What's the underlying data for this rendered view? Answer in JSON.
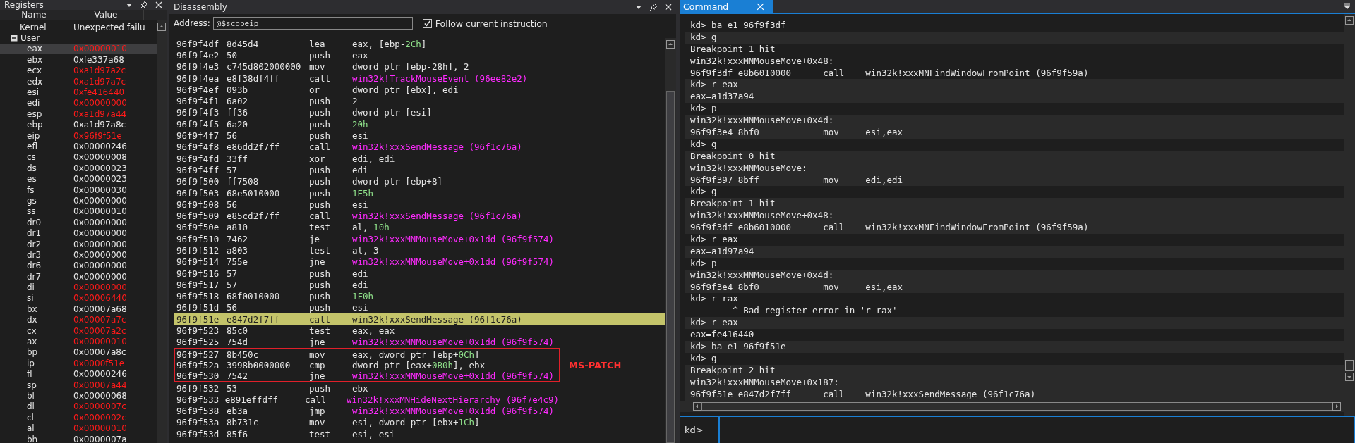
{
  "registers": {
    "title": "Registers",
    "columns": [
      "Name",
      "Value"
    ],
    "kernel": {
      "name": "Kernel",
      "value": "Unexpected failu"
    },
    "user": {
      "name": "User",
      "expanded": true,
      "items": [
        {
          "name": "eax",
          "value": "0x00000010",
          "changed": true,
          "selected": true
        },
        {
          "name": "ebx",
          "value": "0xfe337a68",
          "changed": false,
          "selected": false
        },
        {
          "name": "ecx",
          "value": "0xa1d97a2c",
          "changed": true,
          "selected": false
        },
        {
          "name": "edx",
          "value": "0xa1d97a7c",
          "changed": true,
          "selected": false
        },
        {
          "name": "esi",
          "value": "0xfe416440",
          "changed": true,
          "selected": false
        },
        {
          "name": "edi",
          "value": "0x00000000",
          "changed": true,
          "selected": false
        },
        {
          "name": "esp",
          "value": "0xa1d97a44",
          "changed": true,
          "selected": false
        },
        {
          "name": "ebp",
          "value": "0xa1d97a8c",
          "changed": false,
          "selected": false
        },
        {
          "name": "eip",
          "value": "0x96f9f51e",
          "changed": true,
          "selected": false
        },
        {
          "name": "efl",
          "value": "0x00000246",
          "changed": false,
          "selected": false
        },
        {
          "name": "cs",
          "value": "0x00000008",
          "changed": false,
          "selected": false
        },
        {
          "name": "ds",
          "value": "0x00000023",
          "changed": false,
          "selected": false
        },
        {
          "name": "es",
          "value": "0x00000023",
          "changed": false,
          "selected": false
        },
        {
          "name": "fs",
          "value": "0x00000030",
          "changed": false,
          "selected": false
        },
        {
          "name": "gs",
          "value": "0x00000000",
          "changed": false,
          "selected": false
        },
        {
          "name": "ss",
          "value": "0x00000010",
          "changed": false,
          "selected": false
        },
        {
          "name": "dr0",
          "value": "0x00000000",
          "changed": false,
          "selected": false
        },
        {
          "name": "dr1",
          "value": "0x00000000",
          "changed": false,
          "selected": false
        },
        {
          "name": "dr2",
          "value": "0x00000000",
          "changed": false,
          "selected": false
        },
        {
          "name": "dr3",
          "value": "0x00000000",
          "changed": false,
          "selected": false
        },
        {
          "name": "dr6",
          "value": "0x00000000",
          "changed": false,
          "selected": false
        },
        {
          "name": "dr7",
          "value": "0x00000000",
          "changed": false,
          "selected": false
        },
        {
          "name": "di",
          "value": "0x00000000",
          "changed": true,
          "selected": false
        },
        {
          "name": "si",
          "value": "0x00006440",
          "changed": true,
          "selected": false
        },
        {
          "name": "bx",
          "value": "0x00007a68",
          "changed": false,
          "selected": false
        },
        {
          "name": "dx",
          "value": "0x00007a7c",
          "changed": true,
          "selected": false
        },
        {
          "name": "cx",
          "value": "0x00007a2c",
          "changed": true,
          "selected": false
        },
        {
          "name": "ax",
          "value": "0x00000010",
          "changed": true,
          "selected": false
        },
        {
          "name": "bp",
          "value": "0x00007a8c",
          "changed": false,
          "selected": false
        },
        {
          "name": "ip",
          "value": "0x0000f51e",
          "changed": true,
          "selected": false
        },
        {
          "name": "fl",
          "value": "0x00000246",
          "changed": false,
          "selected": false
        },
        {
          "name": "sp",
          "value": "0x00007a44",
          "changed": true,
          "selected": false
        },
        {
          "name": "bl",
          "value": "0x00000068",
          "changed": false,
          "selected": false
        },
        {
          "name": "dl",
          "value": "0x0000007c",
          "changed": true,
          "selected": false
        },
        {
          "name": "cl",
          "value": "0x0000002c",
          "changed": true,
          "selected": false
        },
        {
          "name": "al",
          "value": "0x00000010",
          "changed": true,
          "selected": false
        },
        {
          "name": "bh",
          "value": "0x0000007a",
          "changed": false,
          "selected": false
        }
      ]
    }
  },
  "disassembly": {
    "title": "Disassembly",
    "address_label": "Address:",
    "address_value": "@$scopeip",
    "follow": {
      "label": "Follow current instruction",
      "checked": true
    },
    "rows": [
      {
        "address": "96f9f4df",
        "bytes": "8d45d4",
        "mnemonic": "lea",
        "operand": [
          {
            "kind": "plain",
            "text": "eax, [ebp-"
          },
          {
            "kind": "number",
            "text": "2Ch"
          },
          {
            "kind": "plain",
            "text": "]"
          }
        ],
        "current": false,
        "boxed": false
      },
      {
        "address": "96f9f4e2",
        "bytes": "50",
        "mnemonic": "push",
        "operand": [
          {
            "kind": "plain",
            "text": "eax"
          }
        ],
        "current": false,
        "boxed": false
      },
      {
        "address": "96f9f4e3",
        "bytes": "c745d802000000",
        "mnemonic": "mov",
        "operand": [
          {
            "kind": "plain",
            "text": "dword ptr [ebp-28h], 2"
          }
        ],
        "current": false,
        "boxed": false
      },
      {
        "address": "96f9f4ea",
        "bytes": "e8f38df4ff",
        "mnemonic": "call",
        "operand": [
          {
            "kind": "symbol",
            "text": "win32k!TrackMouseEvent (96ee82e2)"
          }
        ],
        "current": false,
        "boxed": false
      },
      {
        "address": "96f9f4ef",
        "bytes": "093b",
        "mnemonic": "or",
        "operand": [
          {
            "kind": "plain",
            "text": "dword ptr [ebx], edi"
          }
        ],
        "current": false,
        "boxed": false
      },
      {
        "address": "96f9f4f1",
        "bytes": "6a02",
        "mnemonic": "push",
        "operand": [
          {
            "kind": "plain",
            "text": "2"
          }
        ],
        "current": false,
        "boxed": false
      },
      {
        "address": "96f9f4f3",
        "bytes": "ff36",
        "mnemonic": "push",
        "operand": [
          {
            "kind": "plain",
            "text": "dword ptr [esi]"
          }
        ],
        "current": false,
        "boxed": false
      },
      {
        "address": "96f9f4f5",
        "bytes": "6a20",
        "mnemonic": "push",
        "operand": [
          {
            "kind": "number",
            "text": "20h"
          }
        ],
        "current": false,
        "boxed": false
      },
      {
        "address": "96f9f4f7",
        "bytes": "56",
        "mnemonic": "push",
        "operand": [
          {
            "kind": "plain",
            "text": "esi"
          }
        ],
        "current": false,
        "boxed": false
      },
      {
        "address": "96f9f4f8",
        "bytes": "e86dd2f7ff",
        "mnemonic": "call",
        "operand": [
          {
            "kind": "symbol",
            "text": "win32k!xxxSendMessage (96f1c76a)"
          }
        ],
        "current": false,
        "boxed": false
      },
      {
        "address": "96f9f4fd",
        "bytes": "33ff",
        "mnemonic": "xor",
        "operand": [
          {
            "kind": "plain",
            "text": "edi, edi"
          }
        ],
        "current": false,
        "boxed": false
      },
      {
        "address": "96f9f4ff",
        "bytes": "57",
        "mnemonic": "push",
        "operand": [
          {
            "kind": "plain",
            "text": "edi"
          }
        ],
        "current": false,
        "boxed": false
      },
      {
        "address": "96f9f500",
        "bytes": "ff7508",
        "mnemonic": "push",
        "operand": [
          {
            "kind": "plain",
            "text": "dword ptr [ebp+8]"
          }
        ],
        "current": false,
        "boxed": false
      },
      {
        "address": "96f9f503",
        "bytes": "68e5010000",
        "mnemonic": "push",
        "operand": [
          {
            "kind": "number",
            "text": "1E5h"
          }
        ],
        "current": false,
        "boxed": false
      },
      {
        "address": "96f9f508",
        "bytes": "56",
        "mnemonic": "push",
        "operand": [
          {
            "kind": "plain",
            "text": "esi"
          }
        ],
        "current": false,
        "boxed": false
      },
      {
        "address": "96f9f509",
        "bytes": "e85cd2f7ff",
        "mnemonic": "call",
        "operand": [
          {
            "kind": "symbol",
            "text": "win32k!xxxSendMessage (96f1c76a)"
          }
        ],
        "current": false,
        "boxed": false
      },
      {
        "address": "96f9f50e",
        "bytes": "a810",
        "mnemonic": "test",
        "operand": [
          {
            "kind": "plain",
            "text": "al, "
          },
          {
            "kind": "number",
            "text": "10h"
          }
        ],
        "current": false,
        "boxed": false
      },
      {
        "address": "96f9f510",
        "bytes": "7462",
        "mnemonic": "je",
        "operand": [
          {
            "kind": "symbol",
            "text": "win32k!xxxMNMouseMove+0x1dd (96f9f574)"
          }
        ],
        "current": false,
        "boxed": false
      },
      {
        "address": "96f9f512",
        "bytes": "a803",
        "mnemonic": "test",
        "operand": [
          {
            "kind": "plain",
            "text": "al, 3"
          }
        ],
        "current": false,
        "boxed": false
      },
      {
        "address": "96f9f514",
        "bytes": "755e",
        "mnemonic": "jne",
        "operand": [
          {
            "kind": "symbol",
            "text": "win32k!xxxMNMouseMove+0x1dd (96f9f574)"
          }
        ],
        "current": false,
        "boxed": false
      },
      {
        "address": "96f9f516",
        "bytes": "57",
        "mnemonic": "push",
        "operand": [
          {
            "kind": "plain",
            "text": "edi"
          }
        ],
        "current": false,
        "boxed": false
      },
      {
        "address": "96f9f517",
        "bytes": "57",
        "mnemonic": "push",
        "operand": [
          {
            "kind": "plain",
            "text": "edi"
          }
        ],
        "current": false,
        "boxed": false
      },
      {
        "address": "96f9f518",
        "bytes": "68f0010000",
        "mnemonic": "push",
        "operand": [
          {
            "kind": "number",
            "text": "1F0h"
          }
        ],
        "current": false,
        "boxed": false
      },
      {
        "address": "96f9f51d",
        "bytes": "56",
        "mnemonic": "push",
        "operand": [
          {
            "kind": "plain",
            "text": "esi"
          }
        ],
        "current": false,
        "boxed": false
      },
      {
        "address": "96f9f51e",
        "bytes": "e847d2f7ff",
        "mnemonic": "call",
        "operand": [
          {
            "kind": "symbol",
            "text": "win32k!xxxSendMessage (96f1c76a)"
          }
        ],
        "current": true,
        "boxed": false
      },
      {
        "address": "96f9f523",
        "bytes": "85c0",
        "mnemonic": "test",
        "operand": [
          {
            "kind": "plain",
            "text": "eax, eax"
          }
        ],
        "current": false,
        "boxed": false
      },
      {
        "address": "96f9f525",
        "bytes": "754d",
        "mnemonic": "jne",
        "operand": [
          {
            "kind": "symbol",
            "text": "win32k!xxxMNMouseMove+0x1dd (96f9f574)"
          }
        ],
        "current": false,
        "boxed": false
      },
      {
        "address": "96f9f527",
        "bytes": "8b450c",
        "mnemonic": "mov",
        "operand": [
          {
            "kind": "plain",
            "text": "eax, dword ptr [ebp+"
          },
          {
            "kind": "number",
            "text": "0Ch"
          },
          {
            "kind": "plain",
            "text": "]"
          }
        ],
        "current": false,
        "boxed": true
      },
      {
        "address": "96f9f52a",
        "bytes": "3998b0000000",
        "mnemonic": "cmp",
        "operand": [
          {
            "kind": "plain",
            "text": "dword ptr [eax+"
          },
          {
            "kind": "number",
            "text": "0B0h"
          },
          {
            "kind": "plain",
            "text": "], ebx"
          }
        ],
        "current": false,
        "boxed": true,
        "annotation": "MS-PATCH"
      },
      {
        "address": "96f9f530",
        "bytes": "7542",
        "mnemonic": "jne",
        "operand": [
          {
            "kind": "symbol",
            "text": "win32k!xxxMNMouseMove+0x1dd (96f9f574)"
          }
        ],
        "current": false,
        "boxed": true
      },
      {
        "address": "96f9f532",
        "bytes": "53",
        "mnemonic": "push",
        "operand": [
          {
            "kind": "plain",
            "text": "ebx"
          }
        ],
        "current": false,
        "boxed": false
      },
      {
        "address": "96f9f533",
        "bytes": "e891effdff",
        "mnemonic": "call",
        "operand": [
          {
            "kind": "symbol",
            "text": "win32k!xxxMNHideNextHierarchy (96f7e4c9)"
          }
        ],
        "current": false,
        "boxed": false
      },
      {
        "address": "96f9f538",
        "bytes": "eb3a",
        "mnemonic": "jmp",
        "operand": [
          {
            "kind": "symbol",
            "text": "win32k!xxxMNMouseMove+0x1dd (96f9f574)"
          }
        ],
        "current": false,
        "boxed": false
      },
      {
        "address": "96f9f53a",
        "bytes": "8b731c",
        "mnemonic": "mov",
        "operand": [
          {
            "kind": "plain",
            "text": "esi, dword ptr [ebx+"
          },
          {
            "kind": "number",
            "text": "1Ch"
          },
          {
            "kind": "plain",
            "text": "]"
          }
        ],
        "current": false,
        "boxed": false
      },
      {
        "address": "96f9f53d",
        "bytes": "85f6",
        "mnemonic": "test",
        "operand": [
          {
            "kind": "plain",
            "text": "esi, esi"
          }
        ],
        "current": false,
        "boxed": false
      }
    ]
  },
  "command": {
    "tab": "Command",
    "blocks": [
      [
        "kd> ba e1 96f9f3df"
      ],
      [
        "kd> g"
      ],
      [
        "Breakpoint 1 hit",
        "win32k!xxxMNMouseMove+0x48:",
        "96f9f3df e8b6010000      call    win32k!xxxMNFindWindowFromPoint (96f9f59a)"
      ],
      [
        "kd> r eax",
        "eax=a1d37a94"
      ],
      [
        "kd> p"
      ],
      [
        "win32k!xxxMNMouseMove+0x4d:",
        "96f9f3e4 8bf0            mov     esi,eax"
      ],
      [
        "kd> g"
      ],
      [
        "Breakpoint 0 hit",
        "win32k!xxxMNMouseMove:",
        "96f9f397 8bff            mov     edi,edi"
      ],
      [
        "kd> g"
      ],
      [
        "Breakpoint 1 hit",
        "win32k!xxxMNMouseMove+0x48:",
        "96f9f3df e8b6010000      call    win32k!xxxMNFindWindowFromPoint (96f9f59a)"
      ],
      [
        "kd> r eax"
      ],
      [
        "eax=a1d97a94"
      ],
      [
        "kd> p"
      ],
      [
        "win32k!xxxMNMouseMove+0x4d:",
        "96f9f3e4 8bf0            mov     esi,eax"
      ],
      [
        "kd> r rax",
        "        ^ Bad register error in 'r rax'"
      ],
      [
        "kd> r eax"
      ],
      [
        "eax=fe416440"
      ],
      [
        "kd> ba e1 96f9f51e"
      ],
      [
        "kd> g"
      ],
      [
        "Breakpoint 2 hit",
        "win32k!xxxMNMouseMove+0x187:",
        "96f9f51e e847d2f7ff      call    win32k!xxxSendMessage (96f1c76a)"
      ]
    ],
    "prompt": "kd>"
  }
}
